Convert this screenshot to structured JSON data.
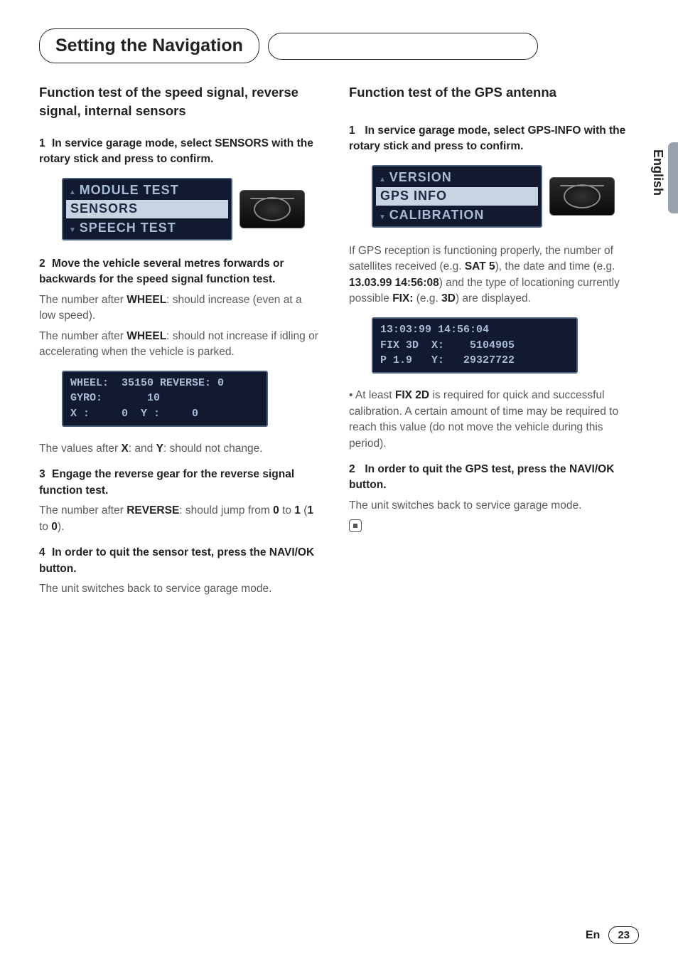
{
  "header": {
    "title": "Setting the Navigation"
  },
  "side": {
    "lang": "English"
  },
  "footer": {
    "lang_short": "En",
    "page": "23"
  },
  "left": {
    "h": "Function test of the speed signal, reverse signal, internal sensors",
    "step1": "In service garage mode, select SENSORS with the rotary stick and press to confirm.",
    "menu": {
      "a": "MODULE TEST",
      "b": "SENSORS",
      "c": "SPEECH TEST"
    },
    "step2": "Move the vehicle several metres forwards or backwards for the speed signal function test.",
    "p2a_pre": "The number after ",
    "p2a_key": "WHEEL",
    "p2a_post": ": should increase (even at a low speed).",
    "p2b_pre": "The number after ",
    "p2b_key": "WHEEL",
    "p2b_post": ": should not increase if idling or accelerating when the vehicle is parked.",
    "disp": "WHEEL:  35150 REVERSE: 0\nGYRO:       10\nX :     0  Y :     0",
    "p2c_pre": "The values after ",
    "p2c_x": "X",
    "p2c_mid": ": and ",
    "p2c_y": "Y",
    "p2c_post": ": should not change.",
    "step3": "Engage the reverse gear for the reverse signal function test.",
    "p3_pre": "The number after ",
    "p3_key": "REVERSE",
    "p3_mid": ": should jump from ",
    "p3_v0": "0",
    "p3_to": " to ",
    "p3_v1": "1",
    "p3_paren_open": " (",
    "p3_v1b": "1",
    "p3_to2": " to ",
    "p3_v0b": "0",
    "p3_close": ").",
    "step4": "In order to quit the sensor test, press the NAVI/OK button.",
    "p4": "The unit switches back to service garage mode."
  },
  "right": {
    "h_pre": "Function test of the ",
    "h_key": "GPS",
    "h_post": " antenna",
    "step1_pre": "In service garage mode, select ",
    "step1_key": "GPS-INFO",
    "step1_post": " with the rotary stick and press to confirm.",
    "menu": {
      "a": "VERSION",
      "b": "GPS INFO",
      "c": "CALIBRATION"
    },
    "p1_a": "If GPS reception is functioning properly, the number of satellites received (e.g. ",
    "p1_sat": "SAT 5",
    "p1_b": "), the date and time (e.g. ",
    "p1_dt": "13.03.99 14:56:08",
    "p1_c": ") and the type of locationing currently possible ",
    "p1_fix": "FIX:",
    "p1_d": " (e.g. ",
    "p1_3d": "3D",
    "p1_e": ") are displayed.",
    "disp": "13:03:99 14:56:04\nFIX 3D  X:    5104905\nP 1.9   Y:   29327722",
    "bul_pre": "• At least ",
    "bul_key": "FIX 2D",
    "bul_post": " is required for quick and successful calibration. A certain amount of time may be required to reach this value (do not move the vehicle during this period).",
    "step2_pre": "In order to quit the ",
    "step2_key": "GPS",
    "step2_post": " test, press the NAVI/OK button.",
    "p2": "The unit switches back to service garage mode."
  }
}
